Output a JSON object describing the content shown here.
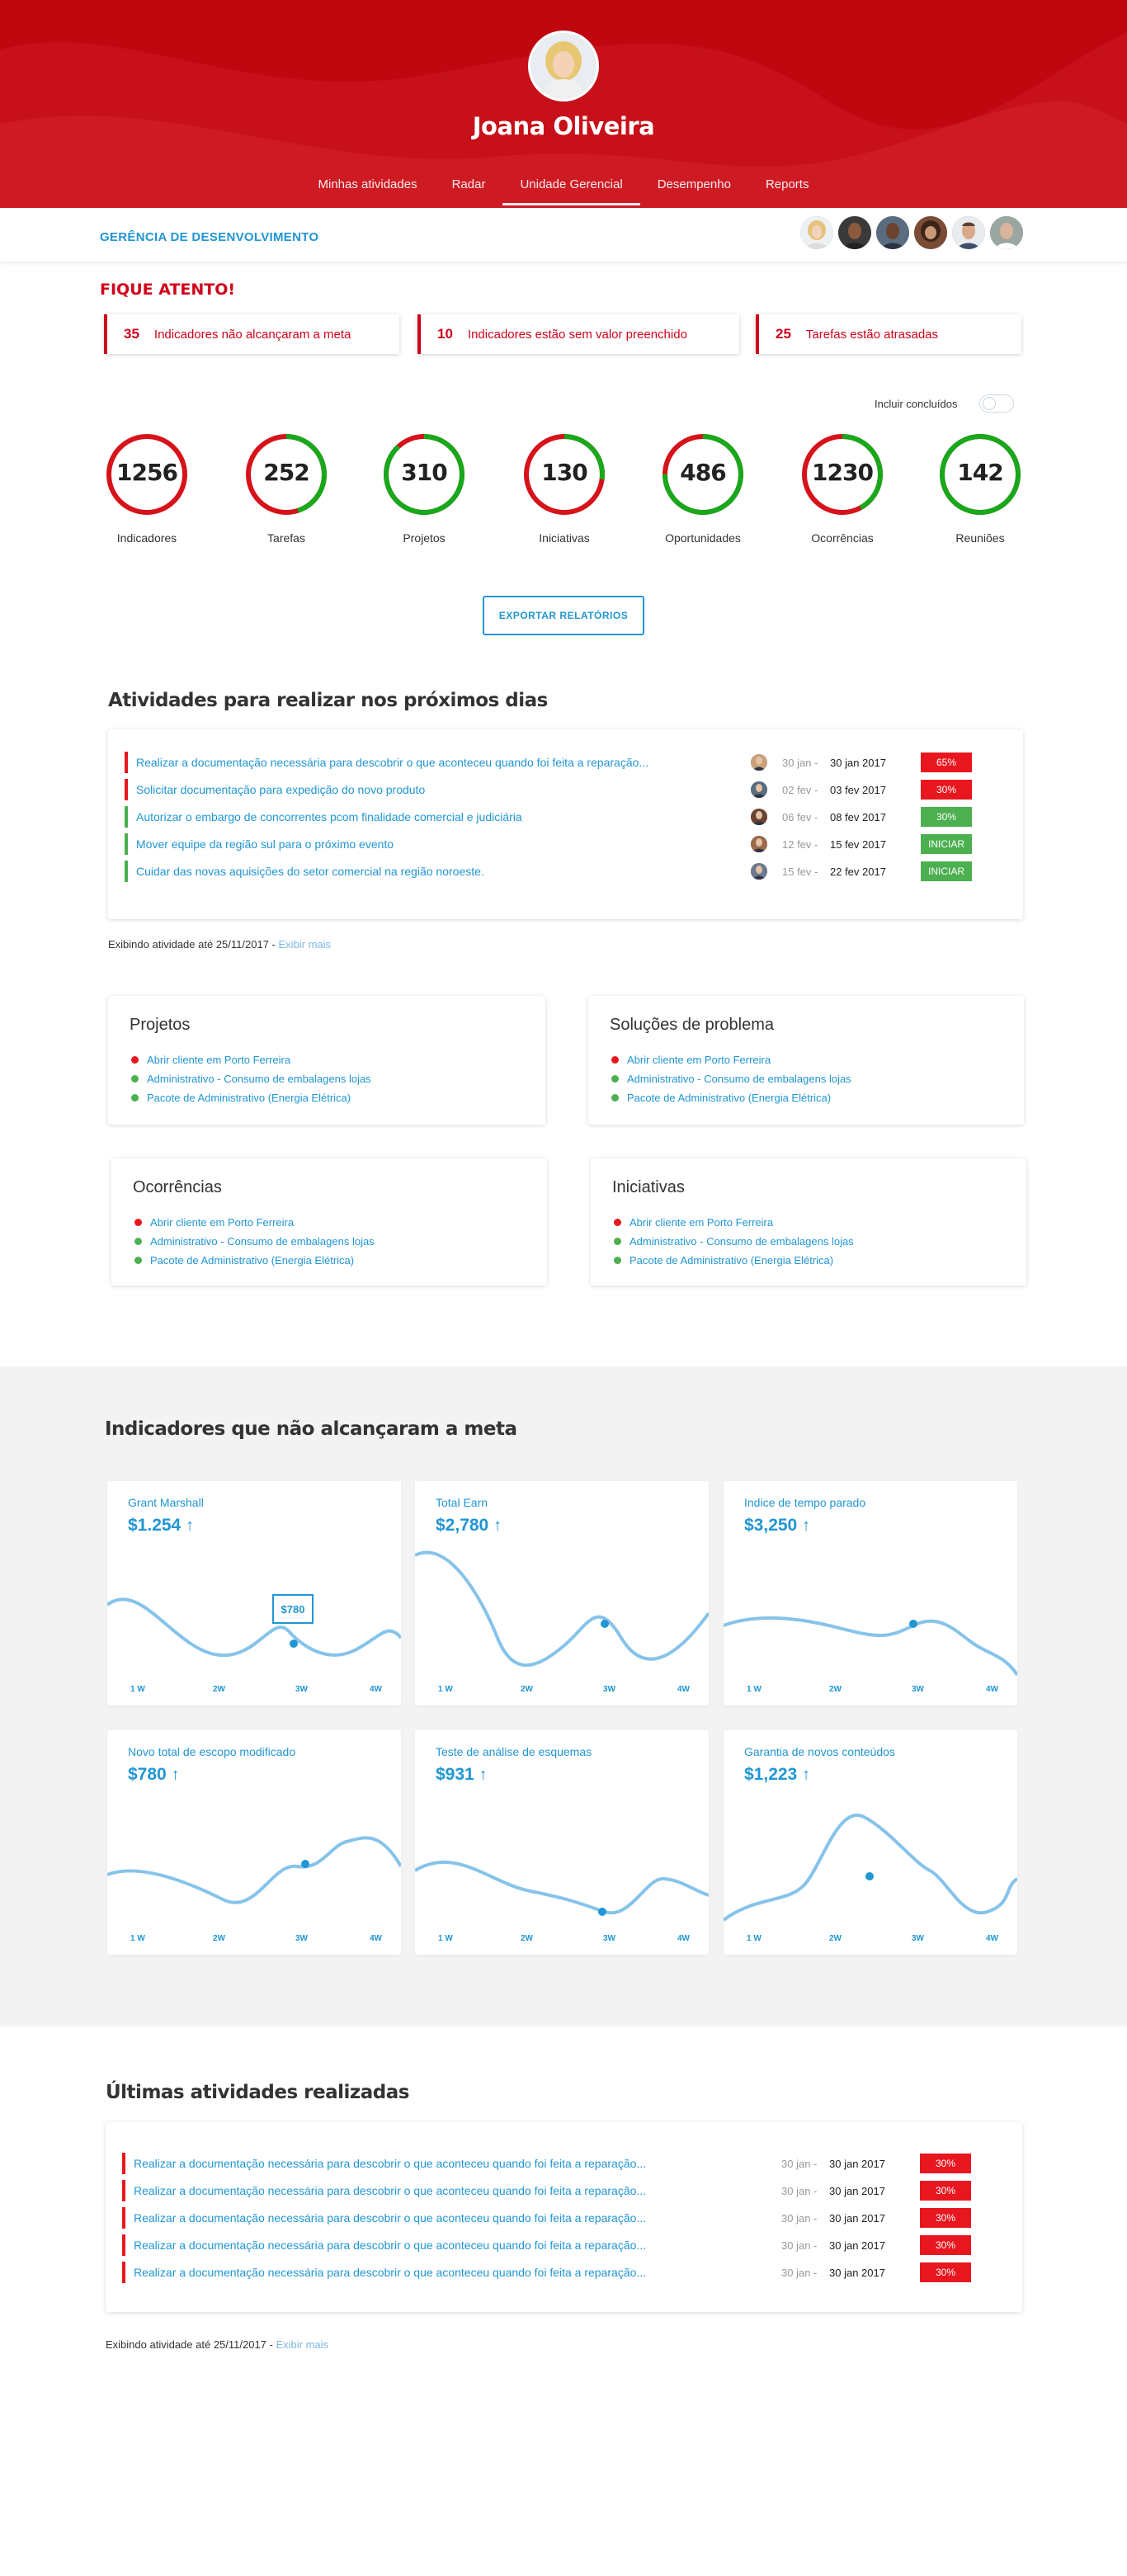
{
  "user": {
    "name": "Joana Oliveira"
  },
  "nav": [
    "Minhas atividades",
    "Radar",
    "Unidade Gerencial",
    "Desempenho",
    "Reports"
  ],
  "nav_active": 2,
  "department": "GERÊNCIA DE DESENVOLVIMENTO",
  "alert": {
    "title": "FIQUE ATENTO!",
    "items": [
      {
        "count": "35",
        "text": "Indicadores não alcançaram a meta"
      },
      {
        "count": "10",
        "text": "Indicadores estão sem valor preenchido"
      },
      {
        "count": "25",
        "text": "Tarefas estão atrasadas"
      }
    ]
  },
  "toggle_label": "Incluir concluídos",
  "stats": [
    {
      "value": "1256",
      "label": "Indicadores",
      "green_fraction": 0.0
    },
    {
      "value": "252",
      "label": "Tarefas",
      "green_fraction": 0.45
    },
    {
      "value": "310",
      "label": "Projetos",
      "green_fraction": 0.88
    },
    {
      "value": "130",
      "label": "Iniciativas",
      "green_fraction": 0.27
    },
    {
      "value": "486",
      "label": "Oportunidades",
      "green_fraction": 0.75
    },
    {
      "value": "1230",
      "label": "Ocorrências",
      "green_fraction": 0.42
    },
    {
      "value": "142",
      "label": "Reuniões",
      "green_fraction": 1.0
    }
  ],
  "export_label": "EXPORTAR RELATÓRIOS",
  "upcoming": {
    "title": "Atividades para realizar nos próximos dias",
    "rows": [
      {
        "text": "Realizar a documentação necessária para descobrir o que aconteceu quando foi feita a reparação...",
        "start": "30 jan -",
        "end": "30 jan 2017",
        "badge": "65%",
        "status": "red"
      },
      {
        "text": "Solicitar documentação para expedição do novo produto",
        "start": "02 fev -",
        "end": "03 fev 2017",
        "badge": "30%",
        "status": "red"
      },
      {
        "text": "Autorizar o embargo de concorrentes pcom finalidade comercial e judiciária",
        "start": "06 fev -",
        "end": "08 fev 2017",
        "badge": "30%",
        "status": "green"
      },
      {
        "text": "Mover equipe da região sul para o próximo evento",
        "start": "12 fev -",
        "end": "15 fev 2017",
        "badge": "INICIAR",
        "status": "green"
      },
      {
        "text": "Cuidar das novas aquisições do setor comercial na região noroeste.",
        "start": "15 fev -",
        "end": "22 fev 2017",
        "badge": "INICIAR",
        "status": "green"
      }
    ],
    "footer": "Exibindo atividade até 25/11/2017 -",
    "more": "Exibir mais"
  },
  "lists": [
    {
      "title": "Projetos",
      "items": [
        {
          "text": "Abrir cliente em Porto Ferreira",
          "status": "red"
        },
        {
          "text": "Administrativo - Consumo de embalagens lojas",
          "status": "green"
        },
        {
          "text": "Pacote de Administrativo (Energia Elétrica)",
          "status": "green"
        }
      ]
    },
    {
      "title": "Soluções de problema",
      "items": [
        {
          "text": "Abrir cliente em Porto Ferreira",
          "status": "red"
        },
        {
          "text": "Administrativo - Consumo de embalagens lojas",
          "status": "green"
        },
        {
          "text": "Pacote de Administrativo (Energia Elétrica)",
          "status": "green"
        }
      ]
    },
    {
      "title": "Ocorrências",
      "items": [
        {
          "text": "Abrir cliente em Porto Ferreira",
          "status": "red"
        },
        {
          "text": "Administrativo - Consumo de embalagens lojas",
          "status": "green"
        },
        {
          "text": "Pacote de Administrativo (Energia Elétrica)",
          "status": "green"
        }
      ]
    },
    {
      "title": "Iniciativas",
      "items": [
        {
          "text": "Abrir cliente em Porto Ferreira",
          "status": "red"
        },
        {
          "text": "Administrativo - Consumo de embalagens lojas",
          "status": "green"
        },
        {
          "text": "Pacote de Administrativo (Energia Elétrica)",
          "status": "green"
        }
      ]
    }
  ],
  "metrics": {
    "title": "Indicadores que não alcançaram a meta",
    "x_labels": [
      "1 W",
      "2W",
      "3W",
      "4W"
    ],
    "cards": [
      {
        "title": "Grant Marshall",
        "value": "$1.254",
        "tooltip": "$780"
      },
      {
        "title": "Total Earn",
        "value": "$2,780"
      },
      {
        "title": "Indice de tempo parado",
        "value": "$3,250"
      },
      {
        "title": "Novo total de escopo modificado",
        "value": "$780"
      },
      {
        "title": "Teste de análise de esquemas",
        "value": "$931"
      },
      {
        "title": "Garantia de novos conteúdos",
        "value": "$1,223"
      }
    ]
  },
  "recent": {
    "title": "Últimas atividades realizadas",
    "rows": [
      {
        "text": "Realizar a documentação necessária para descobrir o que aconteceu quando foi feita a reparação...",
        "start": "30 jan -",
        "end": "30 jan 2017",
        "badge": "30%"
      },
      {
        "text": "Realizar a documentação necessária para descobrir o que aconteceu quando foi feita a reparação...",
        "start": "30 jan -",
        "end": "30 jan 2017",
        "badge": "30%"
      },
      {
        "text": "Realizar a documentação necessária para descobrir o que aconteceu quando foi feita a reparação...",
        "start": "30 jan -",
        "end": "30 jan 2017",
        "badge": "30%"
      },
      {
        "text": "Realizar a documentação necessária para descobrir o que aconteceu quando foi feita a reparação...",
        "start": "30 jan -",
        "end": "30 jan 2017",
        "badge": "30%"
      },
      {
        "text": "Realizar a documentação necessária para descobrir o que aconteceu quando foi feita a reparação...",
        "start": "30 jan -",
        "end": "30 jan 2017",
        "badge": "30%"
      }
    ],
    "footer": "Exibindo atividade até 25/11/2017 -",
    "more": "Exibir mais"
  },
  "colors": {
    "brand_red": "#c0060f",
    "alert_red": "#e8171f",
    "green": "#4caf50",
    "ring_green": "#18a81b",
    "ring_red": "#d6121a",
    "blue": "#2196d3",
    "chart_line": "#86c3ea"
  }
}
